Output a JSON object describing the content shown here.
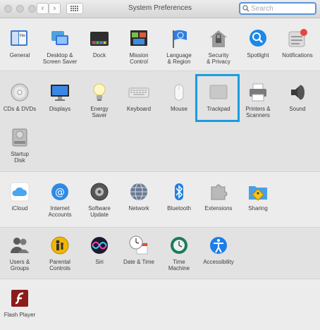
{
  "window": {
    "title": "System Preferences",
    "search_placeholder": "Search"
  },
  "sections": [
    {
      "items": [
        {
          "label": "General",
          "icon": "general-icon"
        },
        {
          "label": "Desktop &\nScreen Saver",
          "icon": "desktop-icon"
        },
        {
          "label": "Dock",
          "icon": "dock-icon"
        },
        {
          "label": "Mission\nControl",
          "icon": "mission-control-icon"
        },
        {
          "label": "Language\n& Region",
          "icon": "language-flag-icon"
        },
        {
          "label": "Security\n& Privacy",
          "icon": "security-house-icon"
        },
        {
          "label": "Spotlight",
          "icon": "spotlight-magnifier-icon"
        },
        {
          "label": "Notifications",
          "icon": "notifications-icon"
        }
      ]
    },
    {
      "items": [
        {
          "label": "CDs & DVDs",
          "icon": "cd-icon"
        },
        {
          "label": "Displays",
          "icon": "display-icon"
        },
        {
          "label": "Energy\nSaver",
          "icon": "lightbulb-icon"
        },
        {
          "label": "Keyboard",
          "icon": "keyboard-icon"
        },
        {
          "label": "Mouse",
          "icon": "mouse-icon"
        },
        {
          "label": "Trackpad",
          "icon": "trackpad-icon"
        },
        {
          "label": "Printers &\nScanners",
          "icon": "printer-icon"
        },
        {
          "label": "Sound",
          "icon": "speaker-icon"
        },
        {
          "label": "Startup\nDisk",
          "icon": "hard-disk-icon"
        }
      ]
    },
    {
      "items": [
        {
          "label": "iCloud",
          "icon": "icloud-icon"
        },
        {
          "label": "Internet\nAccounts",
          "icon": "at-sign-icon"
        },
        {
          "label": "Software\nUpdate",
          "icon": "software-update-gear-icon"
        },
        {
          "label": "Network",
          "icon": "network-globe-icon"
        },
        {
          "label": "Bluetooth",
          "icon": "bluetooth-icon"
        },
        {
          "label": "Extensions",
          "icon": "puzzle-piece-icon"
        },
        {
          "label": "Sharing",
          "icon": "sharing-folder-icon"
        }
      ]
    },
    {
      "items": [
        {
          "label": "Users &\nGroups",
          "icon": "users-icon"
        },
        {
          "label": "Parental\nControls",
          "icon": "parental-controls-icon"
        },
        {
          "label": "Siri",
          "icon": "siri-icon"
        },
        {
          "label": "Date & Time",
          "icon": "calendar-clock-icon"
        },
        {
          "label": "Time\nMachine",
          "icon": "time-machine-icon"
        },
        {
          "label": "Accessibility",
          "icon": "accessibility-icon"
        }
      ]
    },
    {
      "items": [
        {
          "label": "Flash Player",
          "icon": "flash-player-icon"
        }
      ]
    }
  ],
  "selected_pane": "Trackpad",
  "colors": {
    "selection": "#1a9ce0",
    "background": "#ececec",
    "band": "#e2e2e2"
  }
}
